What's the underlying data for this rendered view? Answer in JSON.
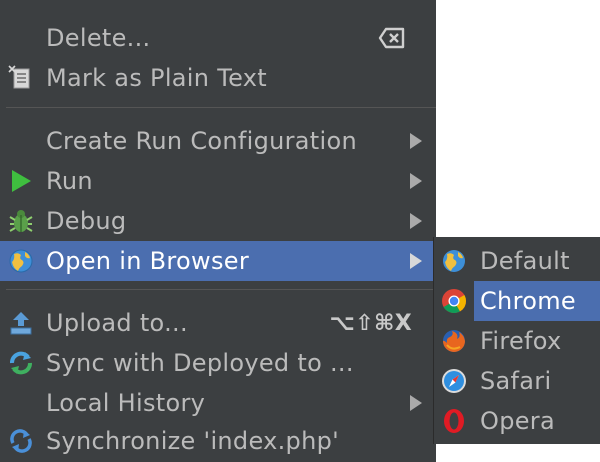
{
  "menu": {
    "items": [
      {
        "label": "Delete...",
        "icon": "delete-key-icon"
      },
      {
        "label": "Mark as Plain Text",
        "icon": "plain-text-icon"
      },
      {
        "label": "Create Run Configuration",
        "submenu": true
      },
      {
        "label": "Run",
        "icon": "run-icon",
        "submenu": true
      },
      {
        "label": "Debug",
        "icon": "debug-icon",
        "submenu": true
      },
      {
        "label": "Open in Browser",
        "icon": "globe-icon",
        "submenu": true,
        "selected": true
      },
      {
        "label": "Upload to...",
        "icon": "upload-icon",
        "shortcut": "⌥⇧⌘X"
      },
      {
        "label": "Sync with Deployed to ...",
        "icon": "sync-icon"
      },
      {
        "label": "Local History",
        "submenu": true
      },
      {
        "label": "Synchronize 'index.php'",
        "icon": "synchronize-icon"
      }
    ]
  },
  "browser_submenu": {
    "items": [
      {
        "label": "Default",
        "icon": "globe-icon"
      },
      {
        "label": "Chrome",
        "icon": "chrome-icon",
        "selected": true
      },
      {
        "label": "Firefox",
        "icon": "firefox-icon"
      },
      {
        "label": "Safari",
        "icon": "safari-icon"
      },
      {
        "label": "Opera",
        "icon": "opera-icon"
      }
    ]
  },
  "colors": {
    "menu_bg": "#3c3f41",
    "selection": "#4b6eaf",
    "text": "#bbbbbb",
    "selected_text": "#ffffff"
  }
}
